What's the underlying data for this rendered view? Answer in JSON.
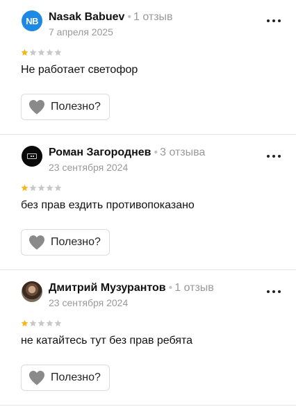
{
  "reviews": [
    {
      "author": "Nasak Babuev",
      "avatar_initials": "NB",
      "avatar_type": "initials",
      "review_count": "1 отзыв",
      "date": "7 апреля 2025",
      "rating": 1,
      "rating_max": 5,
      "text": "Не работает светофор",
      "helpful_label": "Полезно?"
    },
    {
      "author": "Роман Загороднев",
      "avatar_type": "dark-logo",
      "review_count": "3 отзыва",
      "date": "23 сентября 2024",
      "rating": 1,
      "rating_max": 5,
      "text": "без прав ездить противопоказано",
      "helpful_label": "Полезно?"
    },
    {
      "author": "Дмитрий Музурантов",
      "avatar_type": "photo",
      "review_count": "1 отзыв",
      "date": "23 сентября 2024",
      "rating": 1,
      "rating_max": 5,
      "text": "не катайтесь тут без прав ребята",
      "helpful_label": "Полезно?"
    }
  ],
  "separator_glyph": "•",
  "icons": {
    "star": "star-icon",
    "heart": "heart-icon",
    "more": "more-dots-icon"
  },
  "colors": {
    "star_filled": "#f8b61c",
    "star_empty": "#c8c8c8",
    "avatar_initials_bg": "#1e88e5",
    "heart": "#8a8a8a",
    "muted_text": "#999999",
    "divider": "#e4e4e4"
  }
}
